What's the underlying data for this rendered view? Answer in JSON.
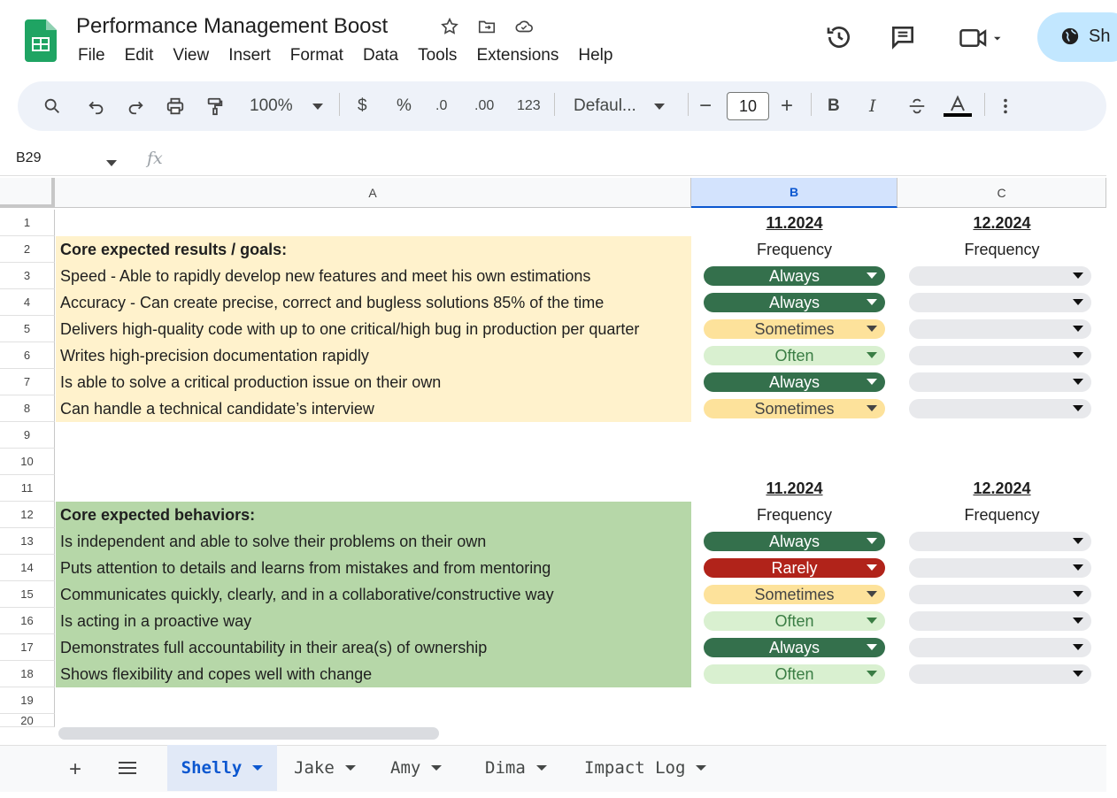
{
  "title": "Performance Management Boost",
  "menu": [
    "File",
    "Edit",
    "View",
    "Insert",
    "Format",
    "Data",
    "Tools",
    "Extensions",
    "Help"
  ],
  "share_label": "Sh",
  "toolbar": {
    "zoom": "100%",
    "currency": "$",
    "percent": "%",
    "dec_dec": ".0",
    "inc_dec": ".00",
    "format_num": "123",
    "font": "Defaul...",
    "font_size": "10",
    "bold": "B",
    "italic": "I"
  },
  "namebox": "B29",
  "fx": "fx",
  "columns": [
    "A",
    "B",
    "C"
  ],
  "rows": [
    "1",
    "2",
    "3",
    "4",
    "5",
    "6",
    "7",
    "8",
    "9",
    "10",
    "11",
    "12",
    "13",
    "14",
    "15",
    "16",
    "17",
    "18",
    "19",
    "20"
  ],
  "section1": {
    "date_b": "11.2024",
    "date_c": "12.2024",
    "heading": "Core expected results / goals:",
    "freq_b": "Frequency",
    "freq_c": "Frequency",
    "items": [
      {
        "text": "Speed - Able to rapidly develop new features and meet his own estimations",
        "value": "Always"
      },
      {
        "text": "Accuracy - Can create precise, correct and bugless solutions 85% of the time",
        "value": "Always"
      },
      {
        "text": "Delivers high-quality code with up to one critical/high bug in production per quarter",
        "value": "Sometimes"
      },
      {
        "text": "Writes high-precision documentation rapidly",
        "value": "Often"
      },
      {
        "text": "Is able to solve a critical production issue on their own",
        "value": "Always"
      },
      {
        "text": "Can handle a technical candidate’s interview",
        "value": "Sometimes"
      }
    ]
  },
  "section2": {
    "date_b": "11.2024",
    "date_c": "12.2024",
    "heading": "Core expected behaviors:",
    "freq_b": "Frequency",
    "freq_c": "Frequency",
    "items": [
      {
        "text": "Is independent and able to solve their problems on their own",
        "value": "Always"
      },
      {
        "text": "Puts attention to details and learns from mistakes and from mentoring",
        "value": "Rarely"
      },
      {
        "text": "Communicates quickly, clearly, and in a collaborative/constructive way",
        "value": "Sometimes"
      },
      {
        "text": "Is acting in a proactive way",
        "value": "Often"
      },
      {
        "text": "Demonstrates full accountability in their area(s) of ownership",
        "value": "Always"
      },
      {
        "text": "Shows flexibility and copes well with change",
        "value": "Often"
      }
    ]
  },
  "tabs": [
    "Shelly",
    "Jake",
    "Amy",
    "Dima",
    "Impact Log"
  ],
  "colors": {
    "always": "#34704c",
    "sometimes": "#fde29b",
    "often": "#d9f0d0",
    "rarely": "#b1231a",
    "goals_bg": "#fff2cc",
    "behaviors_bg": "#b6d7a8"
  }
}
